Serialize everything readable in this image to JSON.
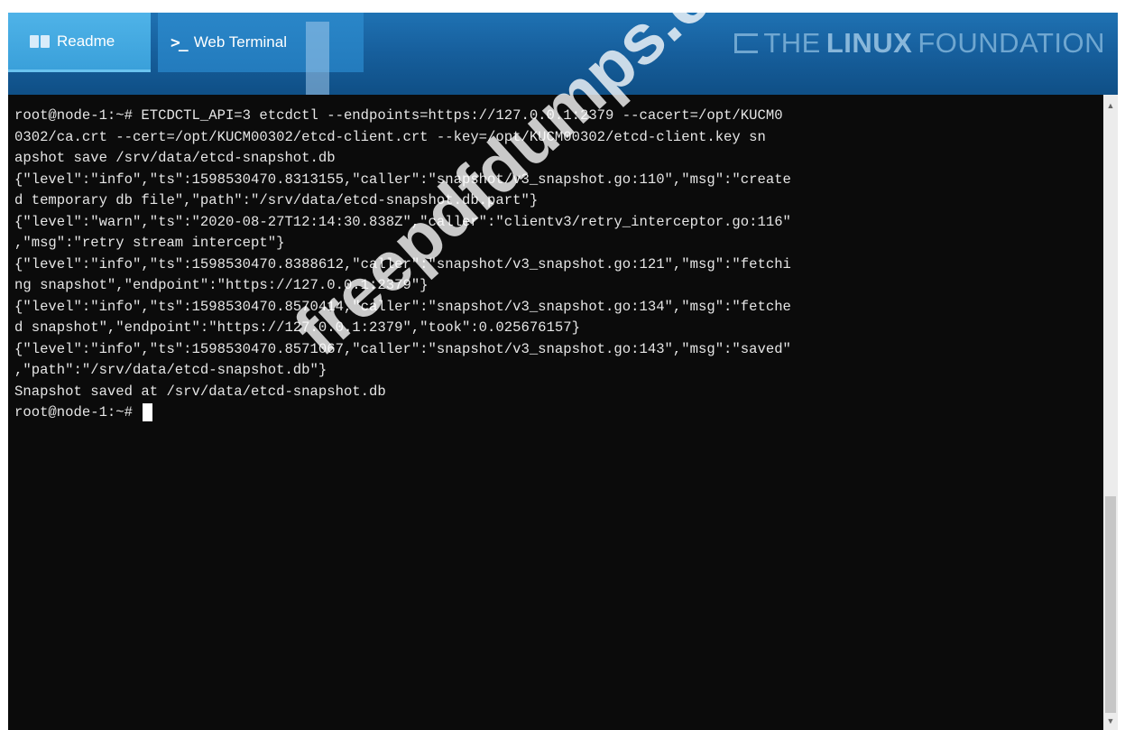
{
  "tabs": [
    {
      "label": "Readme",
      "icon": "book-icon"
    },
    {
      "label": "Web Terminal",
      "icon": "terminal-icon"
    }
  ],
  "brand": {
    "prefix": "THE",
    "strong": "LINUX",
    "suffix": "FOUNDATION"
  },
  "terminal": {
    "lines": [
      "root@node-1:~# ETCDCTL_API=3 etcdctl --endpoints=https://127.0.0.1:2379 --cacert=/opt/KUCM0",
      "0302/ca.crt --cert=/opt/KUCM00302/etcd-client.crt --key=/opt/KUCM00302/etcd-client.key sn",
      "apshot save /srv/data/etcd-snapshot.db",
      "{\"level\":\"info\",\"ts\":1598530470.8313155,\"caller\":\"snapshot/v3_snapshot.go:110\",\"msg\":\"create",
      "d temporary db file\",\"path\":\"/srv/data/etcd-snapshot.db.part\"}",
      "{\"level\":\"warn\",\"ts\":\"2020-08-27T12:14:30.838Z\",\"caller\":\"clientv3/retry_interceptor.go:116\"",
      ",\"msg\":\"retry stream intercept\"}",
      "{\"level\":\"info\",\"ts\":1598530470.8388612,\"caller\":\"snapshot/v3_snapshot.go:121\",\"msg\":\"fetchi",
      "ng snapshot\",\"endpoint\":\"https://127.0.0.1:2379\"}",
      "{\"level\":\"info\",\"ts\":1598530470.8570414,\"caller\":\"snapshot/v3_snapshot.go:134\",\"msg\":\"fetche",
      "d snapshot\",\"endpoint\":\"https://127.0.0.1:2379\",\"took\":0.025676157}",
      "{\"level\":\"info\",\"ts\":1598530470.8571067,\"caller\":\"snapshot/v3_snapshot.go:143\",\"msg\":\"saved\"",
      ",\"path\":\"/srv/data/etcd-snapshot.db\"}",
      "Snapshot saved at /srv/data/etcd-snapshot.db"
    ],
    "prompt": "root@node-1:~# "
  },
  "watermark": "freepdfdumps.com"
}
